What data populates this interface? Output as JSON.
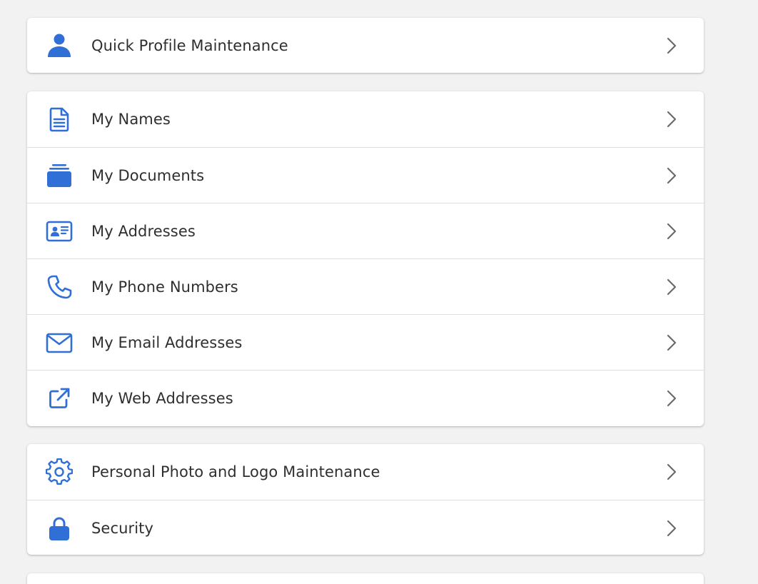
{
  "theme": {
    "accent": "#2f6fd6",
    "text": "#2f2f2f",
    "background": "#f2f2f2",
    "divider": "#dedede",
    "chevron": "#6b6b6b"
  },
  "groups": [
    {
      "items": [
        {
          "label": "Quick Profile Maintenance",
          "icon": "user-icon"
        }
      ]
    },
    {
      "items": [
        {
          "label": "My Names",
          "icon": "document-icon"
        },
        {
          "label": "My Documents",
          "icon": "stack-icon"
        },
        {
          "label": "My Addresses",
          "icon": "id-card-icon"
        },
        {
          "label": "My Phone Numbers",
          "icon": "phone-icon"
        },
        {
          "label": "My Email Addresses",
          "icon": "envelope-icon"
        },
        {
          "label": "My Web Addresses",
          "icon": "external-link-icon"
        }
      ]
    },
    {
      "items": [
        {
          "label": "Personal Photo and Logo Maintenance",
          "icon": "gear-icon"
        },
        {
          "label": "Security",
          "icon": "lock-icon"
        }
      ]
    }
  ]
}
